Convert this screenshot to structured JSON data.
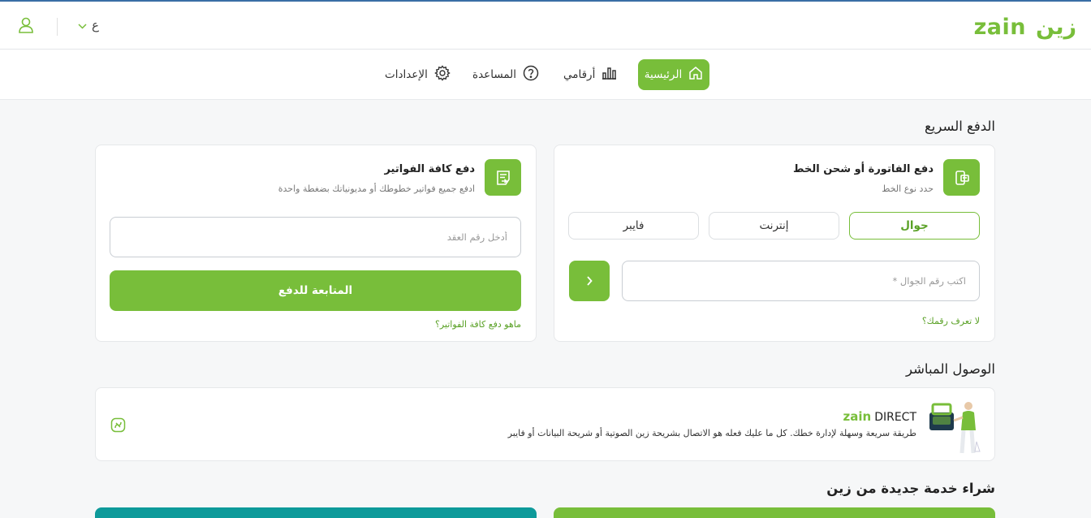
{
  "header": {
    "logo_latin": "zain",
    "logo_arabic": "زين",
    "language": "ع"
  },
  "nav": {
    "items": [
      {
        "label": "الرئيسية",
        "icon": "home-icon",
        "active": true
      },
      {
        "label": "أرقامي",
        "icon": "numbers-icon",
        "active": false
      },
      {
        "label": "المساعدة",
        "icon": "help-icon",
        "active": false
      },
      {
        "label": "الإعدادات",
        "icon": "settings-icon",
        "active": false
      }
    ]
  },
  "quick_pay": {
    "title": "الدفع السريع",
    "bill_card": {
      "title": "دفع الفاتورة أو شحن الخط",
      "subtitle": "حدد نوع الخط",
      "line_types": [
        "جوال",
        "إنترنت",
        "فايبر"
      ],
      "selected_type": "جوال",
      "phone_placeholder": "اكتب رقم الجوال *",
      "help_link": "لا تعرف رقمك؟"
    },
    "all_bills_card": {
      "title": "دفع كافة الفواتير",
      "subtitle": "ادفع جميع فواتير خطوطك أو مديونياتك بضغطة واحدة",
      "contract_placeholder": "أدخل رقم العقد",
      "continue_label": "المتابعة للدفع",
      "info_link": "ماهو دفع كافة الفواتير؟"
    }
  },
  "direct_access": {
    "title": "الوصول المباشر",
    "brand_zain": "zain",
    "brand_direct": "DIRECT",
    "description": "طريقة سريعة وسهلة لإدارة خطك. كل ما عليك فعله هو الاتصال بشريحة زين الصوتية أو شريحة البيانات أو فايبر"
  },
  "new_service": {
    "title": "شراء خدمة جديدة من زين"
  },
  "colors": {
    "brand_green": "#78be3a",
    "teal": "#0e9a9a",
    "accent_blue": "#3a6ea5"
  }
}
